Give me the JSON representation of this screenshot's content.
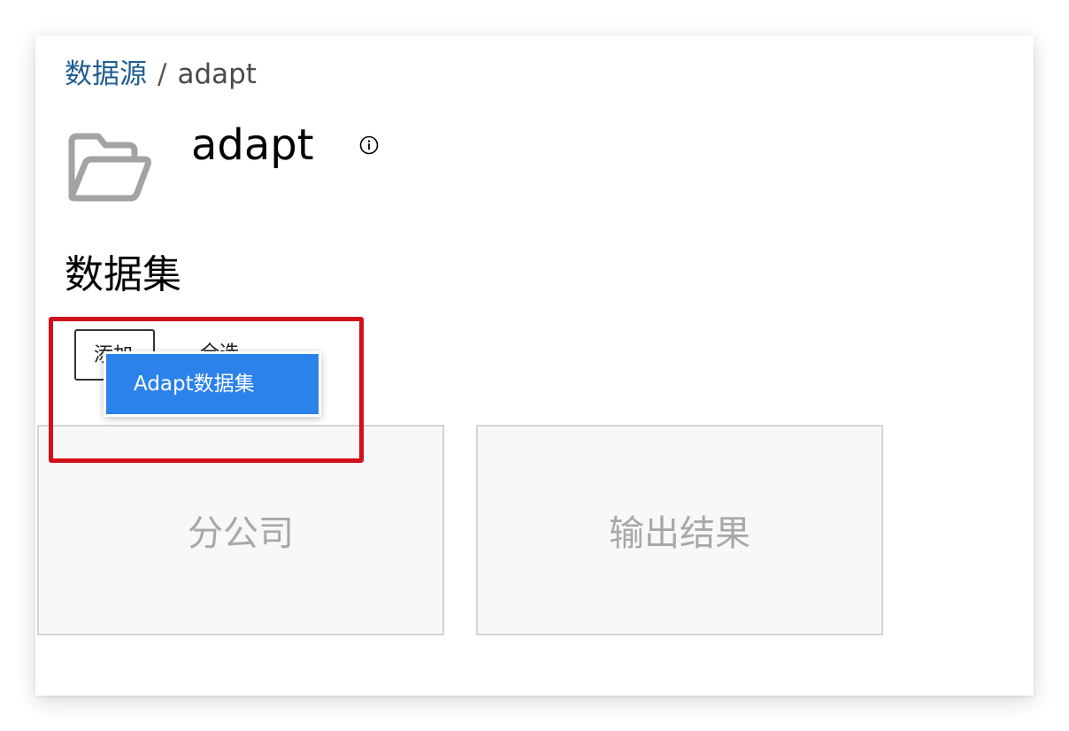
{
  "breadcrumb": {
    "parent": "数据源",
    "separator": "/",
    "current": "adapt"
  },
  "header": {
    "title": "adapt",
    "folder_icon": "folder-open-icon",
    "info_icon": "info-icon",
    "icon_color": "#a3a3a3"
  },
  "section": {
    "title": "数据集"
  },
  "toolbar": {
    "add_label": "添加",
    "select_all_label": "全选"
  },
  "dropdown": {
    "items": [
      {
        "label": "Adapt数据集"
      }
    ],
    "item_bg_color": "#2a82ea"
  },
  "annotation": {
    "highlight_color": "#d3101a"
  },
  "datasets": [
    {
      "label": "分公司"
    },
    {
      "label": "输出结果"
    }
  ]
}
